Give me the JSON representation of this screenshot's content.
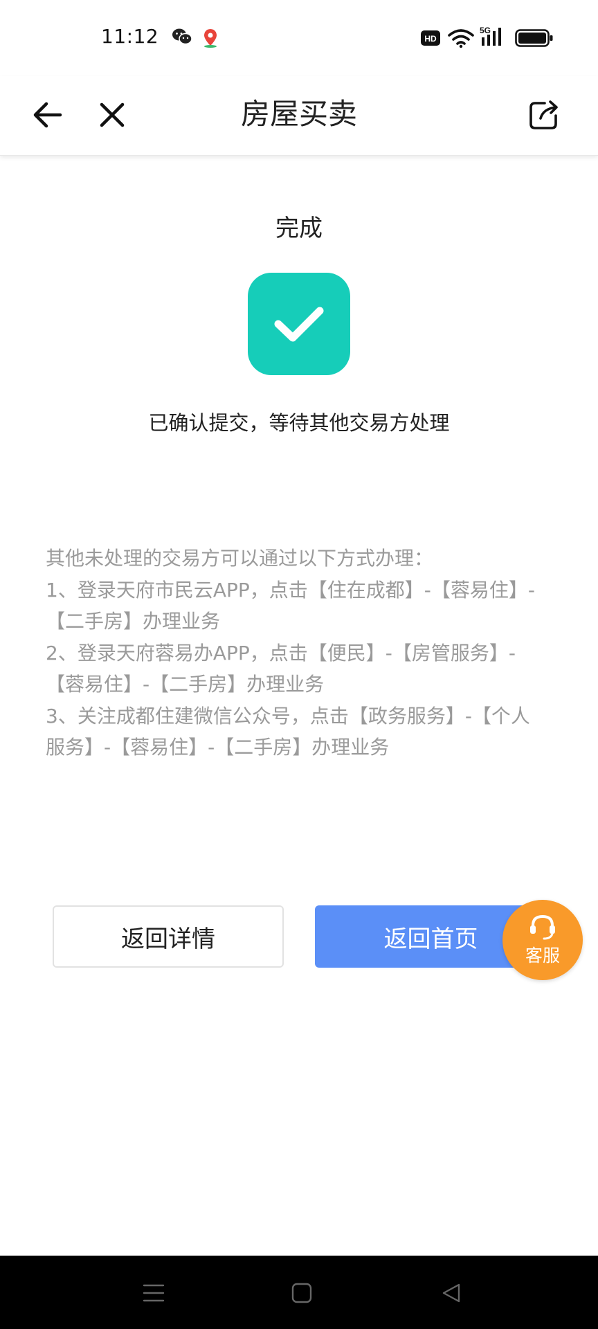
{
  "status_bar": {
    "time": "11:12",
    "left_icons": [
      "wechat-icon",
      "maps-icon"
    ],
    "right_icons": [
      "hd-icon",
      "wifi-icon",
      "signal-5g-icon",
      "battery-icon"
    ],
    "network_label": "5G",
    "hd_label": "HD"
  },
  "navbar": {
    "title": "房屋买卖",
    "back_icon": "arrow-left-icon",
    "close_icon": "close-icon",
    "share_icon": "share-icon"
  },
  "result": {
    "title": "完成",
    "icon": "check-icon",
    "icon_color": "#16cdb9",
    "message": "已确认提交，等待其他交易方处理"
  },
  "instructions": {
    "lines": [
      "其他未处理的交易方可以通过以下方式办理：",
      "1、登录天府市民云APP，点击【住在成都】-【蓉易住】-【二手房】办理业务",
      "2、登录天府蓉易办APP，点击【便民】-【房管服务】-【蓉易住】-【二手房】办理业务",
      "3、关注成都住建微信公众号，点击【政务服务】-【个人服务】-【蓉易住】-【二手房】办理业务"
    ],
    "color": "#9a9a9a"
  },
  "buttons": {
    "back_detail": "返回详情",
    "back_home": "返回首页",
    "primary_color": "#5b8ff7"
  },
  "customer_service": {
    "label": "客服",
    "icon": "headset-icon",
    "color": "#f99a2a"
  },
  "system_nav": {
    "icons": [
      "menu-icon",
      "home-square-icon",
      "back-triangle-icon"
    ]
  }
}
